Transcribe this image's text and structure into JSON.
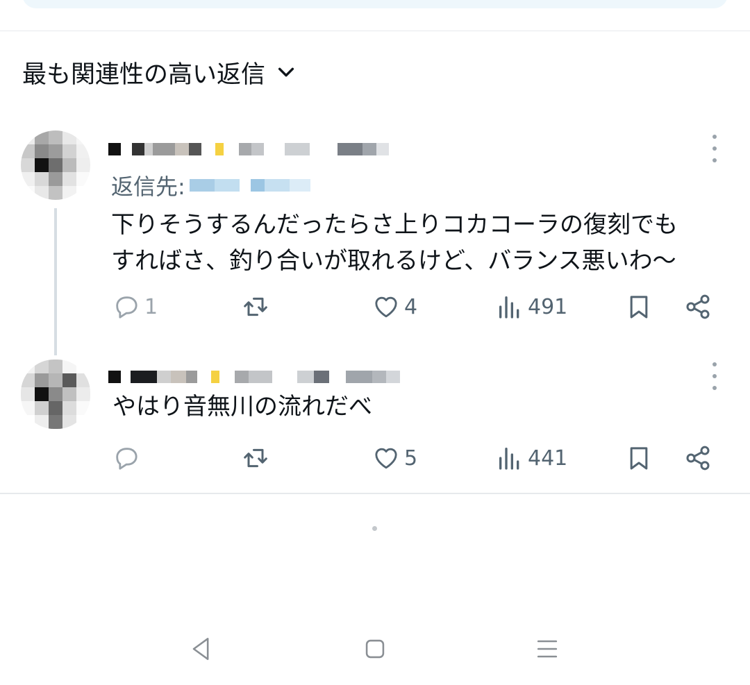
{
  "sort": {
    "label": "最も関連性の高い返信"
  },
  "replies": [
    {
      "reply_to_prefix": "返信先:",
      "text_lines": [
        "下りそうするんだったらさ上りコカコーラの復刻でも",
        "すればさ、釣り合いが取れるけど、バランス悪いわ～"
      ],
      "reply_count": "1",
      "like_count": "4",
      "view_count": "491"
    },
    {
      "text_lines": [
        "やはり音無川の流れだべ"
      ],
      "reply_count": "",
      "like_count": "5",
      "view_count": "441"
    }
  ],
  "colors": {
    "text": "#0f1419",
    "secondary": "#536471",
    "icon": "#536471",
    "divider": "#e6e9ec"
  }
}
